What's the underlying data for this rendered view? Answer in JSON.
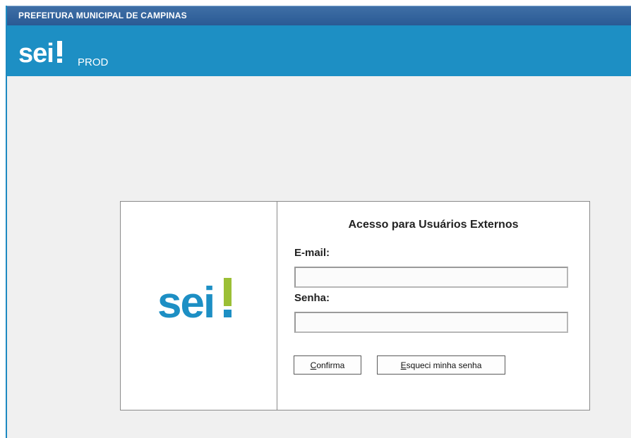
{
  "header": {
    "org_name": "PREFEITURA MUNICIPAL DE CAMPINAS",
    "logo_text": "sei!",
    "environment": "PROD"
  },
  "login": {
    "logo_text": "sei!",
    "title": "Acesso para Usuários Externos",
    "email_label": "E-mail:",
    "email_value": "",
    "senha_label": "Senha:",
    "senha_value": "",
    "confirm_button": {
      "access_key": "C",
      "rest": "onfirma"
    },
    "forgot_button": {
      "access_key": "E",
      "rest": "squeci minha senha"
    }
  },
  "colors": {
    "top_bar": "#2a5a94",
    "brand_bar": "#1d8fc4",
    "logo_blue": "#1d8fc4",
    "logo_green": "#9bbf35",
    "page_bg": "#f0f0f0"
  },
  "icons": [
    "sei-logo-small",
    "sei-logo-large"
  ]
}
